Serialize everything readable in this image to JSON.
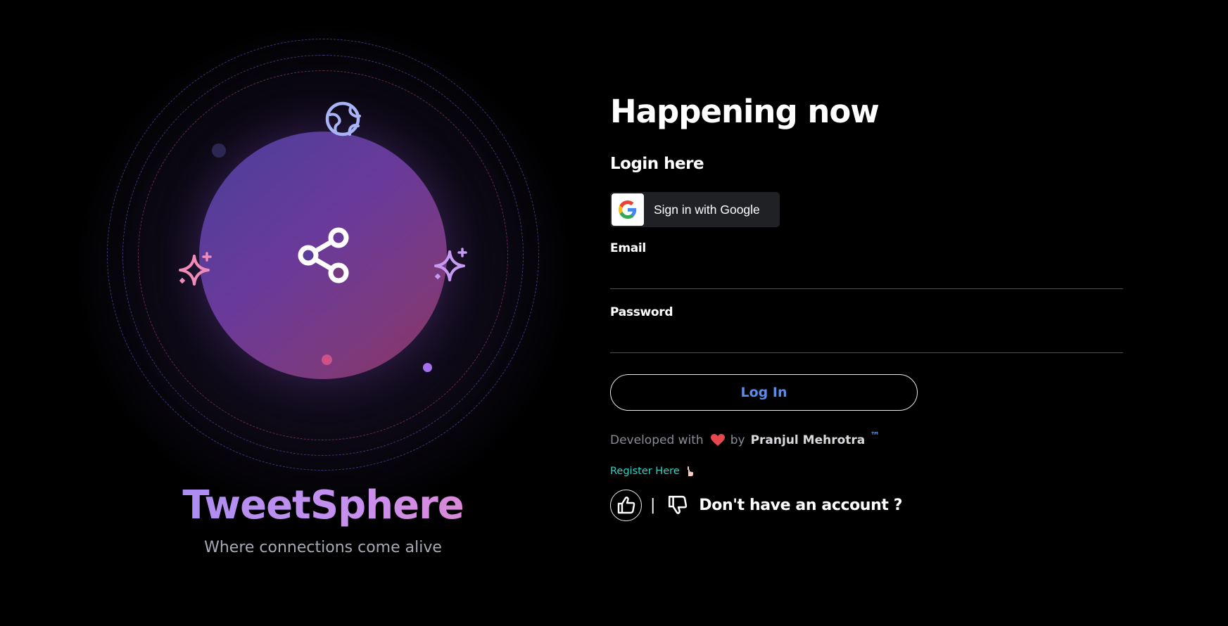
{
  "brand": {
    "name": "TweetSphere",
    "tagline": "Where connections come alive"
  },
  "login": {
    "heading": "Happening now",
    "subheading": "Login here",
    "google_button_label": "Sign in with Google",
    "email_label": "Email",
    "email_value": "",
    "password_label": "Password",
    "password_value": "",
    "login_button_label": "Log In"
  },
  "credits": {
    "prefix": "Developed with",
    "by": "by",
    "author": "Pranjul Mehrotra",
    "trademark": "™"
  },
  "register": {
    "link_label": "Register Here",
    "account_prompt": "Don't have an account ?",
    "separator": "|"
  },
  "icons": {
    "hero_center": "share-icon",
    "hero_top": "globe-icon",
    "hero_left": "sparkle-icon",
    "hero_right": "sparkle-icon",
    "google": "google-g-icon",
    "heart": "heart-icon",
    "register_hand": "pointing-hand-icon",
    "like": "thumbs-up-icon",
    "dislike": "thumbs-down-icon"
  },
  "colors": {
    "background": "#000000",
    "brand_gradient_start": "#a58cf3",
    "brand_gradient_end": "#e186cf",
    "login_button_text": "#5b8ce8",
    "register_link": "#2ad4c9",
    "heart": "#e5484d",
    "orb_start": "#4a3f9b",
    "orb_end": "#8a3460"
  }
}
